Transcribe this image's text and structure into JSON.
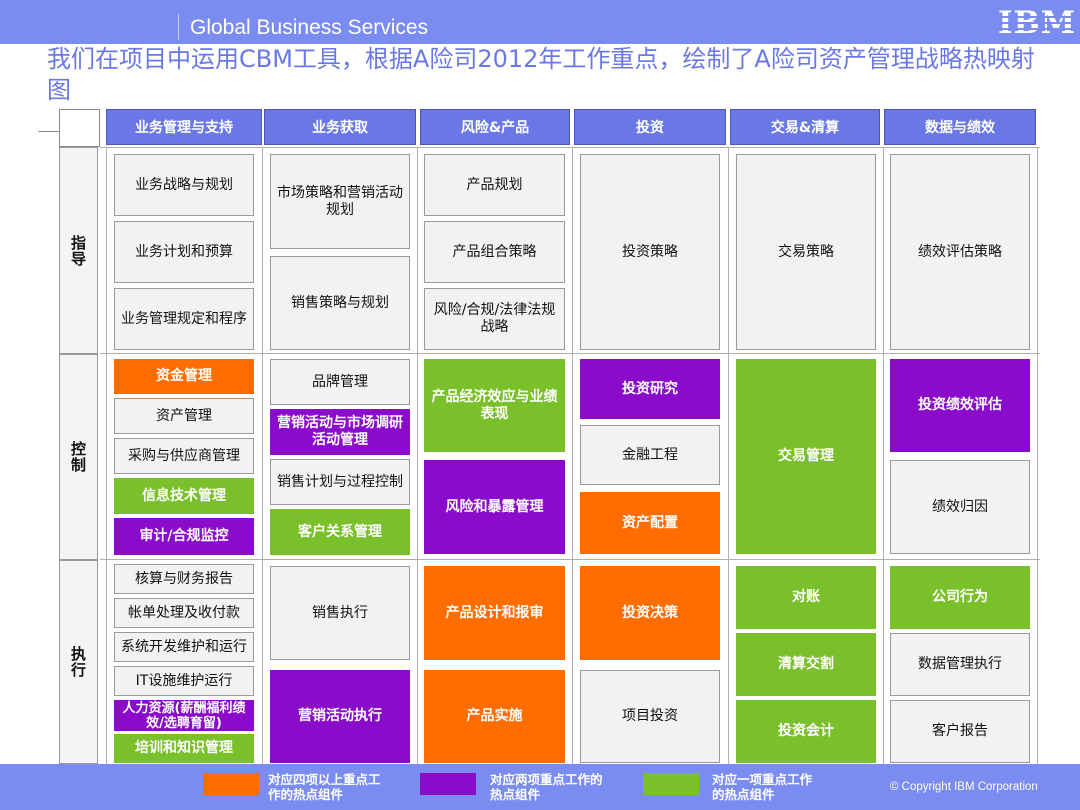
{
  "header": {
    "brand_text": "Global Business Services",
    "logo_text": "IBM"
  },
  "title": "我们在项目中运用CBM工具，根据A险司2012年工作重点，绘制了A险司资产管理战略热映射图",
  "columns": [
    "业务管理与支持",
    "业务获取",
    "风险&产品",
    "投资",
    "交易&清算",
    "数据与绩效"
  ],
  "rows": [
    "指导",
    "控制",
    "执行"
  ],
  "cells": {
    "c1": [
      "业务战略与规划",
      "业务计划和预算",
      "业务管理规定和程序",
      "资金管理",
      "资产管理",
      "采购与供应商管理",
      "信息技术管理",
      "审计/合规监控",
      "核算与财务报告",
      "帐单处理及收付款",
      "系统开发维护和运行",
      "IT设施维护运行",
      "人力资源(薪酬福利绩效/选聘育留)",
      "培训和知识管理"
    ],
    "c2": [
      "市场策略和营销活动规划",
      "销售策略与规划",
      "品牌管理",
      "营销活动与市场调研活动管理",
      "销售计划与过程控制",
      "客户关系管理",
      "销售执行",
      "营销活动执行"
    ],
    "c3": [
      "产品规划",
      "产品组合策略",
      "风险/合规/法律法规战略",
      "产品经济效应与业绩表现",
      "风险和暴露管理",
      "产品设计和报审",
      "产品实施"
    ],
    "c4": [
      "投资策略",
      "投资研究",
      "金融工程",
      "资产配置",
      "投资决策",
      "项目投资"
    ],
    "c5": [
      "交易策略",
      "交易管理",
      "对账",
      "清算交割",
      "投资会计"
    ],
    "c6": [
      "绩效评估策略",
      "投资绩效评估",
      "绩效归因",
      "公司行为",
      "数据管理执行",
      "客户报告"
    ]
  },
  "legend": [
    {
      "label": "对应四项以上重点工作的热点组件",
      "color": "#ff6d00"
    },
    {
      "label": "对应两项重点工作的热点组件",
      "color": "#8a0bc9"
    },
    {
      "label": "对应一项重点工作的热点组件",
      "color": "#7ac02a"
    }
  ],
  "colors": {
    "bar": "#7b8cf0",
    "header": "#6a78e6",
    "orange": "#ff6d00",
    "purple": "#8a0bc9",
    "green": "#7ac02a",
    "gray": "#f2f2f2"
  },
  "footer": {
    "copyright": "© Copyright IBM Corporation"
  }
}
